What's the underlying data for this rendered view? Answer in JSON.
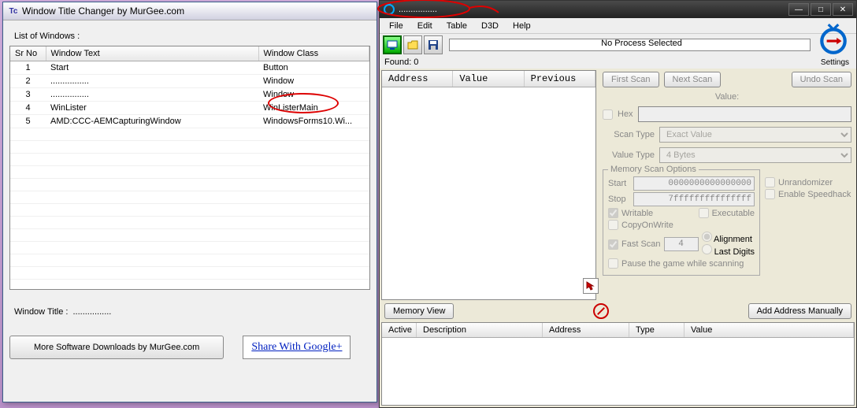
{
  "left": {
    "title": "Window Title Changer by MurGee.com",
    "listLabel": "List of Windows :",
    "cols": {
      "sr": "Sr No",
      "text": "Window Text",
      "class": "Window Class"
    },
    "rows": [
      {
        "n": "1",
        "t": "Start",
        "c": "Button"
      },
      {
        "n": "2",
        "t": "................",
        "c": "Window"
      },
      {
        "n": "3",
        "t": "................",
        "c": "Window"
      },
      {
        "n": "4",
        "t": "WinLister",
        "c": "WinListerMain"
      },
      {
        "n": "5",
        "t": "AMD:CCC-AEMCapturingWindow",
        "c": "WindowsForms10.Wi..."
      }
    ],
    "windowTitleLabel": "Window Title :",
    "windowTitleValue": "................",
    "moreBtn": "More Software Downloads by MurGee.com",
    "shareLink": "Share With Google+"
  },
  "right": {
    "title": "................",
    "menu": {
      "file": "File",
      "edit": "Edit",
      "table": "Table",
      "d3d": "D3D",
      "help": "Help"
    },
    "noProcess": "No Process Selected",
    "settings": "Settings",
    "found": "Found: 0",
    "addrCols": {
      "address": "Address",
      "value": "Value",
      "previous": "Previous"
    },
    "firstScan": "First Scan",
    "nextScan": "Next Scan",
    "undoScan": "Undo Scan",
    "valueLbl": "Value:",
    "hex": "Hex",
    "scanTypeLbl": "Scan Type",
    "scanType": "Exact Value",
    "valueTypeLbl": "Value Type",
    "valueType": "4 Bytes",
    "memTitle": "Memory Scan Options",
    "startLbl": "Start",
    "start": "0000000000000000",
    "stopLbl": "Stop",
    "stop": "7fffffffffffffff",
    "writable": "Writable",
    "executable": "Executable",
    "cow": "CopyOnWrite",
    "fastScan": "Fast Scan",
    "fastVal": "4",
    "alignment": "Alignment",
    "lastDigits": "Last Digits",
    "pause": "Pause the game while scanning",
    "unrandomizer": "Unrandomizer",
    "speedhack": "Enable Speedhack",
    "memoryView": "Memory View",
    "addManual": "Add Address Manually",
    "tbl": {
      "active": "Active",
      "desc": "Description",
      "address": "Address",
      "type": "Type",
      "value": "Value"
    }
  }
}
